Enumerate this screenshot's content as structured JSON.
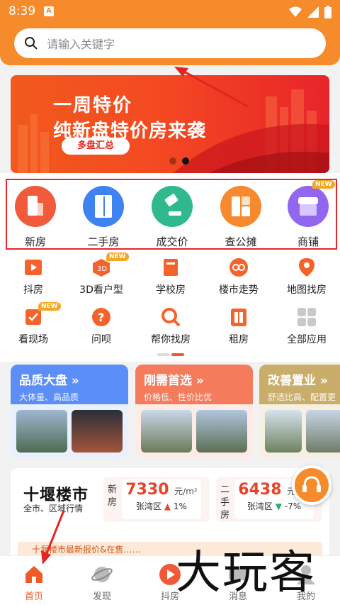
{
  "status_bar": {
    "time": "8:39",
    "app_badge": "A"
  },
  "search": {
    "placeholder": "请输入关键字",
    "icon": "search-icon"
  },
  "banner": {
    "title_line1": "一周特价",
    "title_line2": "纯新盘特价房来袭",
    "pill": "多盘汇总",
    "slides": 2,
    "active_slide": 2
  },
  "primary_nav": [
    {
      "label": "新房",
      "icon": "new-house-icon",
      "color": "#f15a3b"
    },
    {
      "label": "二手房",
      "icon": "door-icon",
      "color": "#3f82f2"
    },
    {
      "label": "成交价",
      "icon": "gavel-icon",
      "color": "#2fb98c"
    },
    {
      "label": "查公摊",
      "icon": "layout-icon",
      "color": "#f78a2e"
    },
    {
      "label": "商铺",
      "icon": "store-icon",
      "color": "#9266ef",
      "badge": "NEW"
    }
  ],
  "secondary_nav": [
    {
      "label": "抖房",
      "icon": "video-icon"
    },
    {
      "label": "3D看户型",
      "icon": "3d-icon",
      "badge": "NEW"
    },
    {
      "label": "学校房",
      "icon": "book-icon"
    },
    {
      "label": "楼市走势",
      "icon": "trend-icon"
    },
    {
      "label": "地图找房",
      "icon": "map-pin-icon"
    },
    {
      "label": "看现场",
      "icon": "onsite-icon",
      "badge": "NEW"
    },
    {
      "label": "问呗",
      "icon": "question-icon"
    },
    {
      "label": "帮你找房",
      "icon": "magnifier-icon"
    },
    {
      "label": "租房",
      "icon": "rent-icon"
    },
    {
      "label": "全部应用",
      "icon": "apps-grid-icon"
    }
  ],
  "promos": [
    {
      "title": "品质大盘 »",
      "sub": "大体量、高品质",
      "bg": "#5b8ef7"
    },
    {
      "title": "刚需首选 »",
      "sub": "价格低、性价比优",
      "bg": "#f47c5c"
    },
    {
      "title": "改善置业 »",
      "sub": "舒适比高、配置更",
      "bg": "#c9ad6a"
    }
  ],
  "market": {
    "logo": "十堰楼市",
    "desc": "全市、区域行情",
    "stats": [
      {
        "type": "新房",
        "price": "7330",
        "unit": "元/m²",
        "area": "张湾区",
        "dir": "▲",
        "change": "1%",
        "color": "#e8432a"
      },
      {
        "type": "二手房",
        "price": "6438",
        "unit": "元/m²",
        "area": "张湾区",
        "dir": "▼",
        "change": "-7%",
        "color": "#2faa6a"
      }
    ],
    "news": "十堰楼市最新报价&在售……"
  },
  "bottom_nav": [
    {
      "label": "首页",
      "icon": "home-icon",
      "active": true
    },
    {
      "label": "发现",
      "icon": "planet-icon"
    },
    {
      "label": "抖房",
      "icon": "play-icon"
    },
    {
      "label": "消息",
      "icon": "message-icon"
    },
    {
      "label": "我的",
      "icon": "user-icon"
    }
  ],
  "watermark": "大玩客"
}
